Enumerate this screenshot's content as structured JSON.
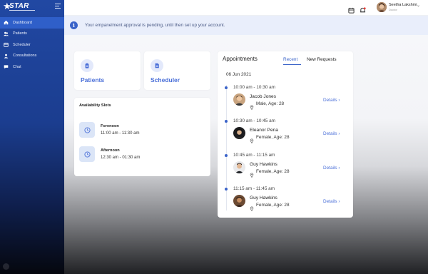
{
  "logo": {
    "text": "STAR"
  },
  "sidebar": {
    "items": [
      {
        "label": "Dashboard",
        "icon": "home-icon",
        "active": true
      },
      {
        "label": "Patients",
        "icon": "patients-icon",
        "active": false
      },
      {
        "label": "Scheduler",
        "icon": "calendar-icon",
        "active": false
      },
      {
        "label": "Consultations",
        "icon": "consultation-icon",
        "active": false
      },
      {
        "label": "Chat",
        "icon": "chat-icon",
        "active": false
      }
    ]
  },
  "header": {
    "user_name": "Seetha Lakshmi",
    "user_role": "Doctor",
    "icons": [
      "calendar-icon",
      "bell-icon"
    ]
  },
  "alert": {
    "message": "Your empanelment approval is pending, until then set up your account."
  },
  "quick_links": [
    {
      "label": "Patients",
      "icon": "patients-clipboard-icon"
    },
    {
      "label": "Scheduler",
      "icon": "scheduler-icon"
    }
  ],
  "availability": {
    "title": "Availability Slots",
    "slots": [
      {
        "name": "Forenoon",
        "time": "11:00 am - 11:30 am"
      },
      {
        "name": "Afternoon",
        "time": "12:30 am - 01:30 am"
      }
    ]
  },
  "appointments": {
    "title": "Appointments",
    "tabs": [
      "Recent",
      "New Requests"
    ],
    "active_tab": "Recent",
    "date": "06 Jun 2021",
    "details_label": "Details",
    "items": [
      {
        "time": "10:00 am - 10:30 am",
        "name": "Jacob Jones",
        "info": "Male, Age: 28"
      },
      {
        "time": "10:30 am - 10:45 am",
        "name": "Eleanor Pena",
        "info": "Female, Age: 28"
      },
      {
        "time": "10:45 am - 11:15 am",
        "name": "Guy Hawkins",
        "info": "Female, Age: 28"
      },
      {
        "time": "11:15 am - 11:45 am",
        "name": "Guy Hawkins",
        "info": "Female, Age: 28"
      }
    ]
  },
  "colors": {
    "accent": "#3a63c9",
    "sidebar": "#2148a3",
    "alert_bg": "#e9eefb"
  }
}
